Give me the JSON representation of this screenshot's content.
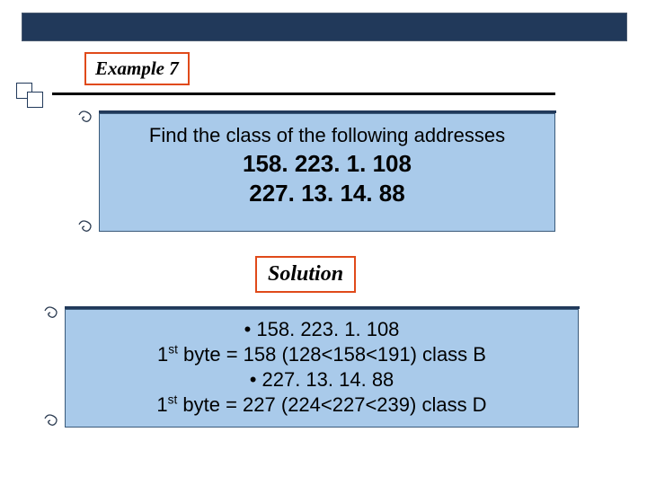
{
  "header": {
    "example_label": "Example 7"
  },
  "problem": {
    "prompt": "Find the class of the following addresses",
    "addr1": "158. 223. 1. 108",
    "addr2": "227. 13. 14. 88"
  },
  "solution_label": "Solution",
  "solution": {
    "line1": "• 158. 223. 1. 108",
    "line2a": "1",
    "line2b": " byte = 158  (128<158<191)  class B",
    "line3": "• 227. 13. 14. 88",
    "line4a": "1",
    "line4b": " byte = 227 (224<227<239) class D",
    "sup": "st"
  }
}
